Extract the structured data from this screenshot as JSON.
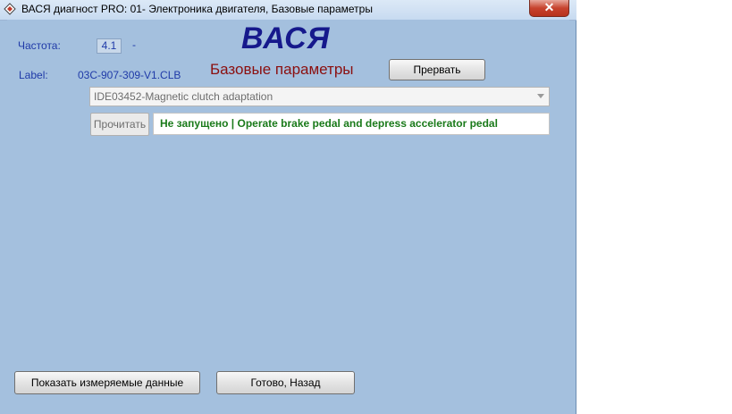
{
  "window": {
    "title": "ВАСЯ диагност PRO: 01- Электроника двигателя,  Базовые параметры",
    "close_glyph": "✕"
  },
  "info": {
    "freq_label": "Частота:",
    "freq_value": "4.1",
    "freq_suffix": "-",
    "label_label": "Label:",
    "label_value": "03C-907-309-V1.CLB"
  },
  "logo": "ВАСЯ",
  "subtitle": "Базовые параметры",
  "buttons": {
    "abort": "Прервать",
    "read": "Прочитать",
    "show_measured": "Показать измеряемые данные",
    "done_back": "Готово, Назад"
  },
  "select": {
    "value": "IDE03452-Magnetic clutch adaptation"
  },
  "status_text": "Не запущено | Operate brake pedal and depress accelerator pedal",
  "colors": {
    "client_bg": "#a4c0de",
    "label_text": "#1f3aa8",
    "logo": "#16198c",
    "subtitle": "#8b0f0f",
    "status_text": "#1a7a1a"
  },
  "icons": [
    "app-icon",
    "close-icon",
    "dropdown-arrow-icon"
  ]
}
